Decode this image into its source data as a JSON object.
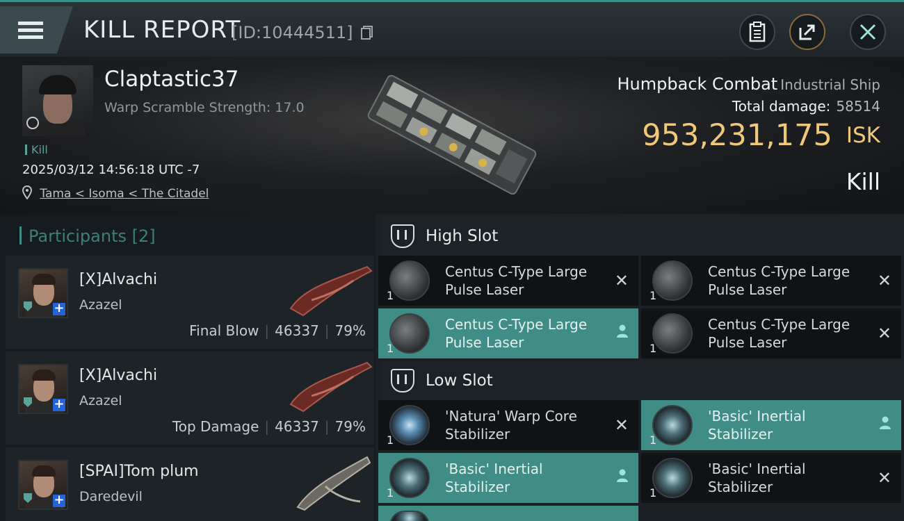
{
  "header": {
    "title": "KILL REPORT",
    "report_id": "[ID:10444511]"
  },
  "victim": {
    "name": "Claptastic37",
    "warp_scramble": "Warp Scramble Strength: 17.0",
    "tag": "Kill",
    "timestamp": "2025/03/12 14:56:18 UTC -7",
    "location": "Tama < Isoma < The Citadel",
    "ship_name": "Humpback Combat",
    "ship_class": "Industrial Ship",
    "total_damage_label": "Total damage:",
    "total_damage_value": "58514",
    "isk_amount": "953,231,175",
    "isk_unit": "ISK",
    "kill_type": "Kill"
  },
  "participants": {
    "title": "Participants [2]",
    "rows": [
      {
        "name": "[X]Alvachi",
        "ship": "Azazel",
        "role": "Final Blow",
        "damage": "46337",
        "percent": "79%"
      },
      {
        "name": "[X]Alvachi",
        "ship": "Azazel",
        "role": "Top Damage",
        "damage": "46337",
        "percent": "79%"
      },
      {
        "name": "[SPAI]Tom plum",
        "ship": "Daredevil"
      }
    ]
  },
  "fitting": {
    "high_slot": {
      "title": "High Slot",
      "modules": [
        {
          "name": "Centus C-Type Large Pulse Laser",
          "qty": "1",
          "status": "destroyed-x"
        },
        {
          "name": "Centus C-Type Large Pulse Laser",
          "qty": "1",
          "status": "destroyed-x"
        },
        {
          "name": "Centus C-Type Large Pulse Laser",
          "qty": "1",
          "status": "dropped-person"
        },
        {
          "name": "Centus C-Type Large Pulse Laser",
          "qty": "1",
          "status": "destroyed-x"
        }
      ]
    },
    "low_slot": {
      "title": "Low Slot",
      "modules": [
        {
          "name": "'Natura' Warp Core Stabilizer",
          "qty": "1",
          "status": "destroyed-x"
        },
        {
          "name": "'Basic' Inertial Stabilizer",
          "qty": "1",
          "status": "dropped-person"
        },
        {
          "name": "'Basic' Inertial Stabilizer",
          "qty": "1",
          "status": "dropped-person"
        },
        {
          "name": "'Basic' Inertial Stabilizer",
          "qty": "1",
          "status": "destroyed-x"
        }
      ]
    }
  },
  "icons": {
    "menu": "hamburger-menu-icon",
    "copy": "copy-icon",
    "clipboard": "clipboard-icon",
    "share": "share-icon",
    "close": "close-icon",
    "location": "map-pin-icon"
  },
  "colors": {
    "accent_teal": "#3f8d86",
    "isk_gold": "#f0c87a",
    "header_bg": "#2b3338"
  }
}
